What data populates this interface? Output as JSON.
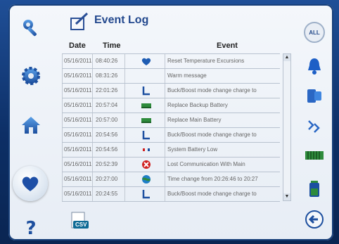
{
  "header": {
    "title": "Event Log"
  },
  "table": {
    "columns": {
      "date": "Date",
      "time": "Time",
      "event": "Event"
    },
    "rows": [
      {
        "date": "05/16/2011",
        "time": "08:40:26",
        "icon": "heart-icon",
        "event": "Reset Temperature Excursions"
      },
      {
        "date": "05/16/2011",
        "time": "08:31:26",
        "icon": "none",
        "event": "Warm message"
      },
      {
        "date": "05/16/2011",
        "time": "22:01:26",
        "icon": "mode-change-icon",
        "event": "Buck/Boost mode change charge to"
      },
      {
        "date": "05/16/2011",
        "time": "20:57:04",
        "icon": "battery-green-icon",
        "event": "Replace Backup Battery"
      },
      {
        "date": "05/16/2011",
        "time": "20:57:00",
        "icon": "battery-green-icon",
        "event": "Replace Main Battery"
      },
      {
        "date": "05/16/2011",
        "time": "20:54:56",
        "icon": "mode-change-icon",
        "event": "Buck/Boost mode change charge to"
      },
      {
        "date": "05/16/2011",
        "time": "20:54:56",
        "icon": "battery-low-icon",
        "event": "System Battery Low"
      },
      {
        "date": "05/16/2011",
        "time": "20:52:39",
        "icon": "error-x-icon",
        "event": "Lost Communication With Main"
      },
      {
        "date": "05/16/2011",
        "time": "20:27:00",
        "icon": "globe-icon",
        "event": "Time change from 20:26:46 to 20:27"
      },
      {
        "date": "05/16/2011",
        "time": "20:24:55",
        "icon": "mode-change-icon",
        "event": "Buck/Boost mode change charge to"
      }
    ]
  },
  "right_rail": {
    "all_label": "ALL"
  },
  "export": {
    "csv_label": "CSV"
  },
  "colors": {
    "accent": "#24498e",
    "heart": "#1e5cb3",
    "green": "#2e8b3c",
    "red": "#d02020"
  }
}
